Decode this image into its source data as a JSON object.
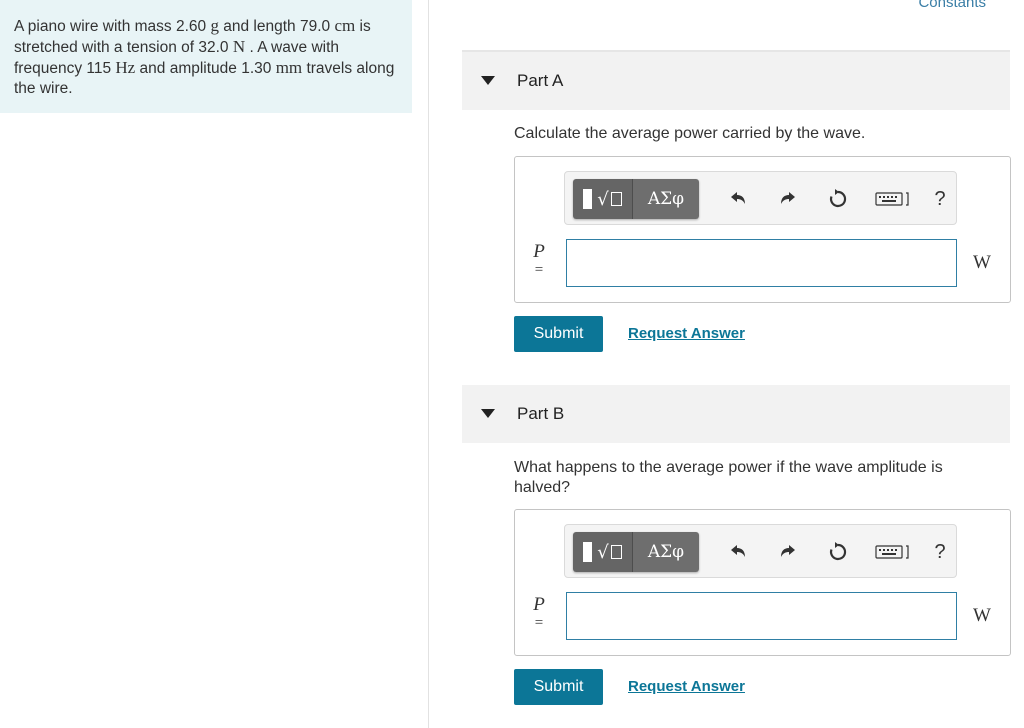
{
  "problem": {
    "seg1": "A piano wire with mass 2.60 ",
    "unit1": "g",
    "seg2": " and length 79.0 ",
    "unit2": "cm",
    "seg3": " is stretched with a tension of 32.0 ",
    "unit3": "N",
    "seg4": " . A wave with frequency 115 ",
    "unit4": "Hz",
    "seg5": " and amplitude 1.30 ",
    "unit5": "mm",
    "seg6": " travels along the wire."
  },
  "constants_link": "Constants",
  "parts": [
    {
      "label": "Part A",
      "question": "Calculate the average power carried by the wave.",
      "variable": "P",
      "equals": "=",
      "input_value": "",
      "unit": "W",
      "submit_label": "Submit",
      "request_label": "Request Answer"
    },
    {
      "label": "Part B",
      "question": "What happens to the average power if the wave amplitude is halved?",
      "variable": "P",
      "equals": "=",
      "input_value": "",
      "unit": "W",
      "submit_label": "Submit",
      "request_label": "Request Answer"
    }
  ],
  "toolbar": {
    "templates_sqrt": "√",
    "symbols_label": "ΑΣφ",
    "help_label": "?",
    "icons": [
      "templates-icon",
      "greek-symbols-icon",
      "undo-icon",
      "redo-icon",
      "reset-icon",
      "keyboard-icon",
      "help-icon"
    ]
  },
  "colors": {
    "problem_bg": "#e8f4f6",
    "accent": "#0c7697",
    "input_border": "#2f7fa4",
    "part_header_bg": "#f2f2f2"
  }
}
